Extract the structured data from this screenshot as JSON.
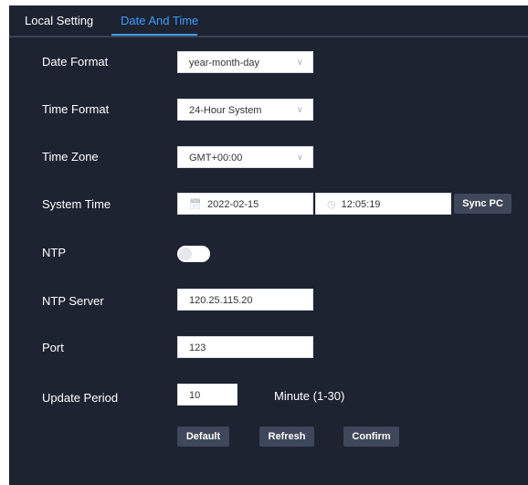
{
  "tabs": [
    {
      "label": "Local Setting",
      "active": false
    },
    {
      "label": "Date And Time",
      "active": true
    }
  ],
  "form": {
    "date_format": {
      "label": "Date Format",
      "value": "year-month-day"
    },
    "time_format": {
      "label": "Time Format",
      "value": "24-Hour System"
    },
    "time_zone": {
      "label": "Time Zone",
      "value": "GMT+00:00"
    },
    "system_time": {
      "label": "System Time",
      "date": "2022-02-15",
      "time": "12:05:19",
      "sync_label": "Sync PC"
    },
    "ntp": {
      "label": "NTP",
      "enabled": false
    },
    "ntp_server": {
      "label": "NTP Server",
      "value": "120.25.115.20"
    },
    "port": {
      "label": "Port",
      "value": "123"
    },
    "update_period": {
      "label": "Update Period",
      "value": "10",
      "unit": "Minute (1-30)"
    }
  },
  "actions": {
    "default_label": "Default",
    "refresh_label": "Refresh",
    "confirm_label": "Confirm"
  },
  "colors": {
    "background": "#1d2331",
    "accent": "#3d9cff",
    "button": "#3f475a"
  }
}
